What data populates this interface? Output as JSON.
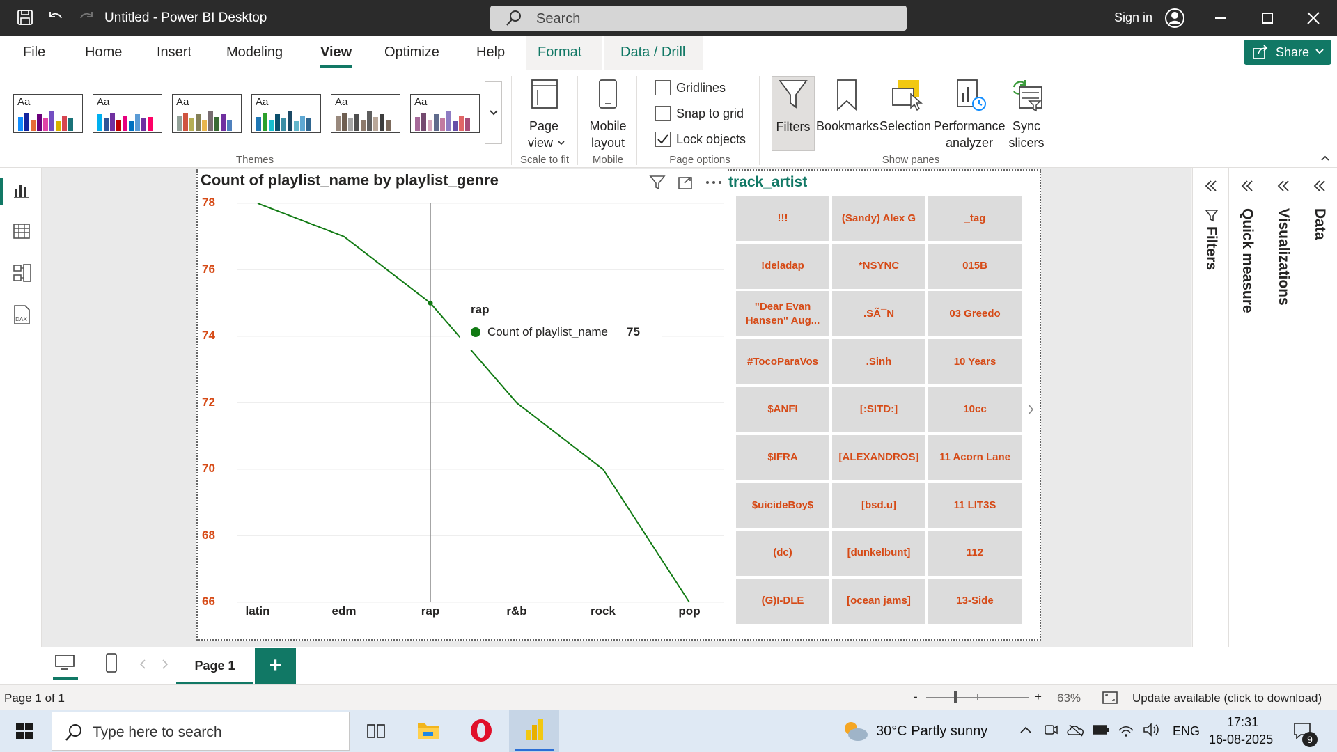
{
  "window": {
    "title": "Untitled - Power BI Desktop",
    "search_placeholder": "Search",
    "sign_in": "Sign in"
  },
  "menu": {
    "items": [
      "File",
      "Home",
      "Insert",
      "Modeling",
      "View",
      "Optimize",
      "Help",
      "Format",
      "Data / Drill"
    ],
    "active": "View",
    "share": "Share"
  },
  "ribbon": {
    "themes_label": "Themes",
    "theme_aa": "Aa",
    "page_view": {
      "line1": "Page",
      "line2": "view",
      "group": "Scale to fit"
    },
    "mobile": {
      "line1": "Mobile",
      "line2": "layout",
      "group": "Mobile"
    },
    "page_options": {
      "group": "Page options",
      "gridlines": {
        "label": "Gridlines",
        "checked": false
      },
      "snap": {
        "label": "Snap to grid",
        "checked": false
      },
      "lock": {
        "label": "Lock objects",
        "checked": true
      }
    },
    "show_panes": {
      "group": "Show panes",
      "filters": "Filters",
      "bookmarks": "Bookmarks",
      "selection": "Selection",
      "performance": {
        "line1": "Performance",
        "line2": "analyzer"
      },
      "sync": {
        "line1": "Sync",
        "line2": "slicers"
      }
    }
  },
  "chart_data": {
    "type": "line",
    "title": "Count of playlist_name by playlist_genre",
    "categories": [
      "latin",
      "edm",
      "rap",
      "r&b",
      "rock",
      "pop"
    ],
    "series": [
      {
        "name": "Count of playlist_name",
        "values": [
          78,
          77,
          75,
          72,
          70,
          66
        ],
        "color": "#117a13"
      }
    ],
    "yticks": [
      "78",
      "76",
      "74",
      "72",
      "70",
      "68",
      "66"
    ],
    "ylim": [
      66,
      78
    ],
    "grid": true
  },
  "tooltip": {
    "title": "rap",
    "label": "Count of playlist_name",
    "value": "75"
  },
  "table": {
    "title": "track_artist",
    "rows": [
      [
        "!!!",
        "(Sandy) Alex G",
        "_tag"
      ],
      [
        "!deladap",
        "*NSYNC",
        "015B"
      ],
      [
        "\"Dear Evan Hansen\" Aug...",
        ".SÃ¯N",
        "03 Greedo"
      ],
      [
        "#TocoParaVos",
        ".Sinh",
        "10 Years"
      ],
      [
        "$ANFI",
        "[:SITD:]",
        "10cc"
      ],
      [
        "$IFRA",
        "[ALEXANDROS]",
        "11 Acorn Lane"
      ],
      [
        "$uicideBoy$",
        "[bsd.u]",
        "11 LIT3S"
      ],
      [
        "(dc)",
        "[dunkelbunt]",
        "112"
      ],
      [
        "(G)I-DLE",
        "[ocean jams]",
        "13-Side"
      ]
    ],
    "cell_color": "#d64a16"
  },
  "panes": {
    "filters": "Filters",
    "quick_measure": "Quick measure",
    "visualizations": "Visualizations",
    "data": "Data"
  },
  "pages": {
    "tab": "Page 1",
    "add": "+"
  },
  "status": {
    "page_info": "Page 1 of 1",
    "zoom": "63%",
    "update": "Update available (click to download)",
    "zoom_minus": "-",
    "zoom_plus": "+"
  },
  "taskbar": {
    "search_placeholder": "Type here to search",
    "weather": "30°C  Partly sunny",
    "lang": "ENG",
    "time": "17:31",
    "date": "16-08-2025",
    "notifications": "9"
  },
  "colors": {
    "accent": "#117865",
    "line": "#117a13",
    "axis_labels": "#d64a16"
  }
}
